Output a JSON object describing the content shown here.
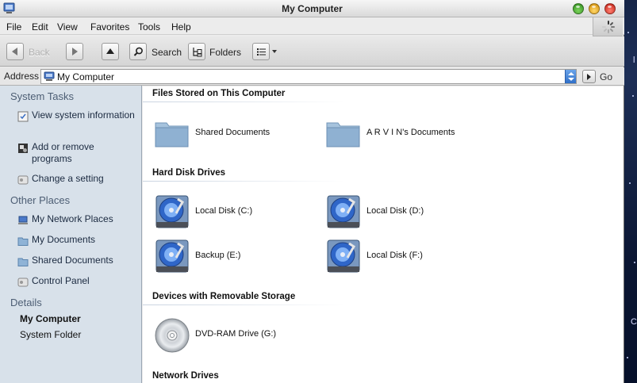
{
  "window": {
    "title": "My Computer"
  },
  "menu": [
    "File",
    "Edit",
    "View",
    "Favorites",
    "Tools",
    "Help"
  ],
  "toolbar": {
    "back_label": "Back",
    "search_label": "Search",
    "folders_label": "Folders"
  },
  "address": {
    "label": "Address",
    "value": "My Computer",
    "go_label": "Go"
  },
  "sidebar": {
    "system_tasks": {
      "title": "System Tasks",
      "items": [
        "View system information",
        "Add or remove programs",
        "Change a setting"
      ]
    },
    "other_places": {
      "title": "Other Places",
      "items": [
        "My Network Places",
        "My Documents",
        "Shared Documents",
        "Control Panel"
      ]
    },
    "details": {
      "title": "Details",
      "name": "My Computer",
      "type": "System Folder"
    }
  },
  "content": {
    "groups": [
      {
        "title": "Files Stored on This Computer",
        "items": [
          "Shared Documents",
          "A R V I N's Documents"
        ]
      },
      {
        "title": "Hard Disk Drives",
        "items": [
          "Local Disk (C:)",
          "Local Disk (D:)",
          "Backup (E:)",
          "Local Disk (F:)"
        ]
      },
      {
        "title": "Devices with Removable Storage",
        "items": [
          "DVD-RAM Drive (G:)"
        ]
      },
      {
        "title": "Network Drives",
        "items": []
      }
    ]
  },
  "desktop_fragment": "C",
  "colors": {
    "sidebar_bg": "#d8e1ea",
    "sidebar_heading": "#4d5e74",
    "address_dropdown": "#3b7fd8"
  }
}
